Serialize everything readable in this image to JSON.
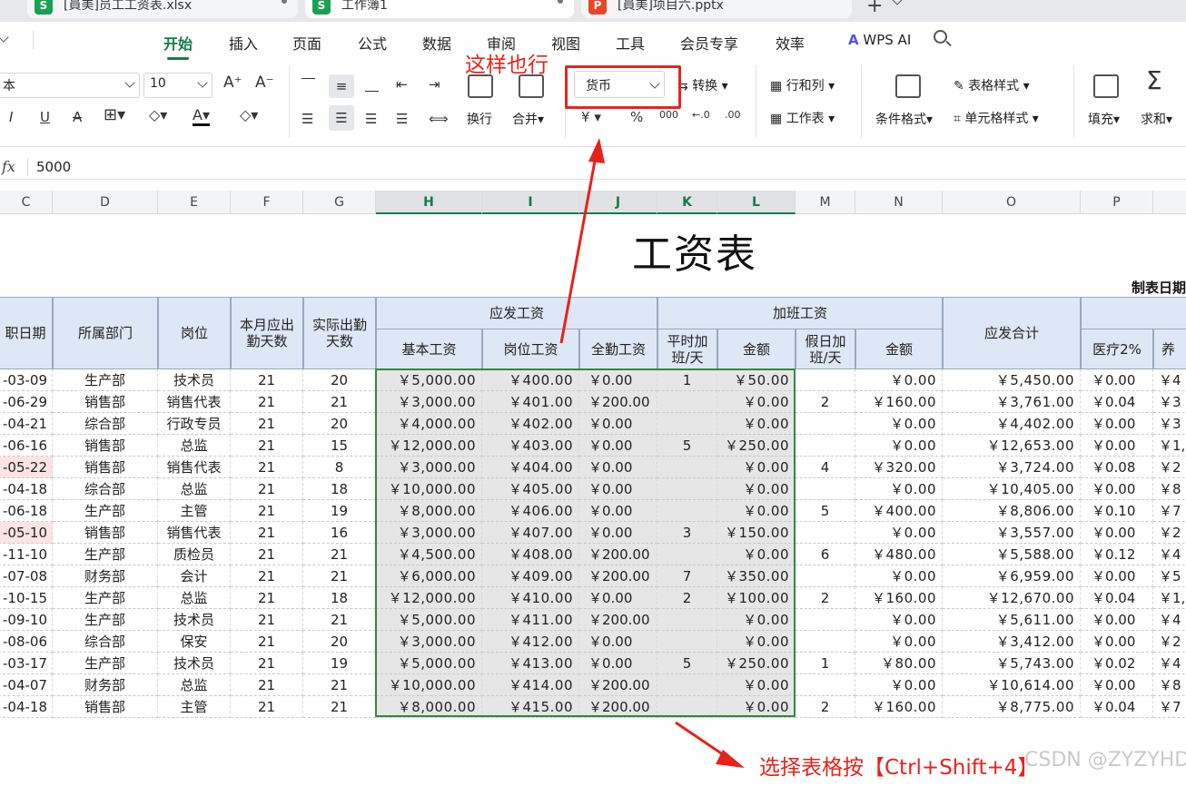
{
  "tabs": [
    {
      "label": "[員美]员工工资表.xlsx",
      "icon": "S",
      "color": "#1aa054"
    },
    {
      "label": "工作簿1",
      "icon": "S",
      "color": "#1aa054"
    },
    {
      "label": "[員美]项目六.pptx",
      "icon": "P",
      "color": "#e8462a"
    }
  ],
  "menu": [
    "开始",
    "插入",
    "页面",
    "公式",
    "数据",
    "审阅",
    "视图",
    "工具",
    "会员专享",
    "效率"
  ],
  "wps_ai": "WPS AI",
  "ribbon": {
    "font_name": "本",
    "font_size": "10",
    "wrap": "换行",
    "merge": "合并",
    "merge_arrow": "合并▾",
    "number_format": "货币",
    "convert": "转换",
    "row_col": "行和列",
    "sheet": "工作表",
    "cond_format": "条件格式",
    "table_style": "表格样式",
    "cell_style": "单元格样式",
    "fill": "填充",
    "sum": "求和",
    "currency_symbol": "¥",
    "percent": "%",
    "thousand": "000"
  },
  "formula": {
    "value": "5000"
  },
  "columns": [
    "C",
    "D",
    "E",
    "F",
    "G",
    "H",
    "I",
    "J",
    "K",
    "L",
    "M",
    "N",
    "O",
    "P"
  ],
  "sheet_title": "工资表",
  "made_date": "制表日期",
  "headers": {
    "entry_date": "职日期",
    "dept": "所属部门",
    "position": "岗位",
    "due_days": "本月应出勤天数",
    "actual_days": "实际出勤天数",
    "payable": "应发工资",
    "basic": "基本工资",
    "post": "岗位工资",
    "full": "全勤工资",
    "overtime": "加班工资",
    "normal_ot": "平时加班/天",
    "normal_amt": "金额",
    "holiday_ot": "假日加班/天",
    "holiday_amt": "金额",
    "total": "应发合计",
    "medical": "医疗2%",
    "pension": "养"
  },
  "rows": [
    {
      "date": "-03-09",
      "dept": "生产部",
      "pos": "技术员",
      "due": "21",
      "act": "20",
      "basic": "￥5,000.00",
      "post": "￥400.00",
      "full": "￥0.00",
      "not": "1",
      "namt": "￥50.00",
      "hot": "",
      "hamt": "￥0.00",
      "total": "￥5,450.00",
      "med": "￥0.00",
      "pen": "￥4",
      "red": false
    },
    {
      "date": "-06-29",
      "dept": "销售部",
      "pos": "销售代表",
      "due": "21",
      "act": "21",
      "basic": "￥3,000.00",
      "post": "￥401.00",
      "full": "￥200.00",
      "not": "",
      "namt": "￥0.00",
      "hot": "2",
      "hamt": "￥160.00",
      "total": "￥3,761.00",
      "med": "￥0.04",
      "pen": "￥3",
      "red": false
    },
    {
      "date": "-04-21",
      "dept": "综合部",
      "pos": "行政专员",
      "due": "21",
      "act": "20",
      "basic": "￥4,000.00",
      "post": "￥402.00",
      "full": "￥0.00",
      "not": "",
      "namt": "￥0.00",
      "hot": "",
      "hamt": "￥0.00",
      "total": "￥4,402.00",
      "med": "￥0.00",
      "pen": "￥3",
      "red": false
    },
    {
      "date": "-06-16",
      "dept": "销售部",
      "pos": "总监",
      "due": "21",
      "act": "15",
      "basic": "￥12,000.00",
      "post": "￥403.00",
      "full": "￥0.00",
      "not": "5",
      "namt": "￥250.00",
      "hot": "",
      "hamt": "￥0.00",
      "total": "￥12,653.00",
      "med": "￥0.00",
      "pen": "￥1,",
      "red": false
    },
    {
      "date": "-05-22",
      "dept": "销售部",
      "pos": "销售代表",
      "due": "21",
      "act": "8",
      "basic": "￥3,000.00",
      "post": "￥404.00",
      "full": "￥0.00",
      "not": "",
      "namt": "￥0.00",
      "hot": "4",
      "hamt": "￥320.00",
      "total": "￥3,724.00",
      "med": "￥0.08",
      "pen": "￥2",
      "red": true
    },
    {
      "date": "-04-18",
      "dept": "综合部",
      "pos": "总监",
      "due": "21",
      "act": "18",
      "basic": "￥10,000.00",
      "post": "￥405.00",
      "full": "￥0.00",
      "not": "",
      "namt": "￥0.00",
      "hot": "",
      "hamt": "￥0.00",
      "total": "￥10,405.00",
      "med": "￥0.00",
      "pen": "￥8",
      "red": false
    },
    {
      "date": "-06-18",
      "dept": "生产部",
      "pos": "主管",
      "due": "21",
      "act": "19",
      "basic": "￥8,000.00",
      "post": "￥406.00",
      "full": "￥0.00",
      "not": "",
      "namt": "￥0.00",
      "hot": "5",
      "hamt": "￥400.00",
      "total": "￥8,806.00",
      "med": "￥0.10",
      "pen": "￥7",
      "red": false
    },
    {
      "date": "-05-10",
      "dept": "销售部",
      "pos": "销售代表",
      "due": "21",
      "act": "16",
      "basic": "￥3,000.00",
      "post": "￥407.00",
      "full": "￥0.00",
      "not": "3",
      "namt": "￥150.00",
      "hot": "",
      "hamt": "￥0.00",
      "total": "￥3,557.00",
      "med": "￥0.00",
      "pen": "￥2",
      "red": true
    },
    {
      "date": "-11-10",
      "dept": "生产部",
      "pos": "质检员",
      "due": "21",
      "act": "21",
      "basic": "￥4,500.00",
      "post": "￥408.00",
      "full": "￥200.00",
      "not": "",
      "namt": "￥0.00",
      "hot": "6",
      "hamt": "￥480.00",
      "total": "￥5,588.00",
      "med": "￥0.12",
      "pen": "￥4",
      "red": false
    },
    {
      "date": "-07-08",
      "dept": "财务部",
      "pos": "会计",
      "due": "21",
      "act": "21",
      "basic": "￥6,000.00",
      "post": "￥409.00",
      "full": "￥200.00",
      "not": "7",
      "namt": "￥350.00",
      "hot": "",
      "hamt": "￥0.00",
      "total": "￥6,959.00",
      "med": "￥0.00",
      "pen": "￥5",
      "red": false
    },
    {
      "date": "-10-15",
      "dept": "生产部",
      "pos": "总监",
      "due": "21",
      "act": "18",
      "basic": "￥12,000.00",
      "post": "￥410.00",
      "full": "￥0.00",
      "not": "2",
      "namt": "￥100.00",
      "hot": "2",
      "hamt": "￥160.00",
      "total": "￥12,670.00",
      "med": "￥0.04",
      "pen": "￥1,",
      "red": false
    },
    {
      "date": "-09-10",
      "dept": "生产部",
      "pos": "技术员",
      "due": "21",
      "act": "21",
      "basic": "￥5,000.00",
      "post": "￥411.00",
      "full": "￥200.00",
      "not": "",
      "namt": "￥0.00",
      "hot": "",
      "hamt": "￥0.00",
      "total": "￥5,611.00",
      "med": "￥0.00",
      "pen": "￥4",
      "red": false
    },
    {
      "date": "-08-06",
      "dept": "综合部",
      "pos": "保安",
      "due": "21",
      "act": "20",
      "basic": "￥3,000.00",
      "post": "￥412.00",
      "full": "￥0.00",
      "not": "",
      "namt": "￥0.00",
      "hot": "",
      "hamt": "￥0.00",
      "total": "￥3,412.00",
      "med": "￥0.00",
      "pen": "￥2",
      "red": false
    },
    {
      "date": "-03-17",
      "dept": "生产部",
      "pos": "技术员",
      "due": "21",
      "act": "19",
      "basic": "￥5,000.00",
      "post": "￥413.00",
      "full": "￥0.00",
      "not": "5",
      "namt": "￥250.00",
      "hot": "1",
      "hamt": "￥80.00",
      "total": "￥5,743.00",
      "med": "￥0.02",
      "pen": "￥4",
      "red": false
    },
    {
      "date": "-04-07",
      "dept": "财务部",
      "pos": "总监",
      "due": "21",
      "act": "21",
      "basic": "￥10,000.00",
      "post": "￥414.00",
      "full": "￥200.00",
      "not": "",
      "namt": "￥0.00",
      "hot": "",
      "hamt": "￥0.00",
      "total": "￥10,614.00",
      "med": "￥0.00",
      "pen": "￥8",
      "red": false
    },
    {
      "date": "-04-18",
      "dept": "销售部",
      "pos": "主管",
      "due": "21",
      "act": "21",
      "basic": "￥8,000.00",
      "post": "￥415.00",
      "full": "￥200.00",
      "not": "",
      "namt": "￥0.00",
      "hot": "2",
      "hamt": "￥160.00",
      "total": "￥8,775.00",
      "med": "￥0.04",
      "pen": "￥7",
      "red": false
    }
  ],
  "annotations": {
    "top": "这样也行",
    "bottom": "选择表格按【Ctrl+Shift+4】",
    "watermark": "CSDN @ZYZYHDQZQ"
  },
  "colors": {
    "accent": "#137a4b",
    "annotation": "#e8221a",
    "header_fill": "#dde7f6",
    "selection": "#2e8a3b"
  }
}
